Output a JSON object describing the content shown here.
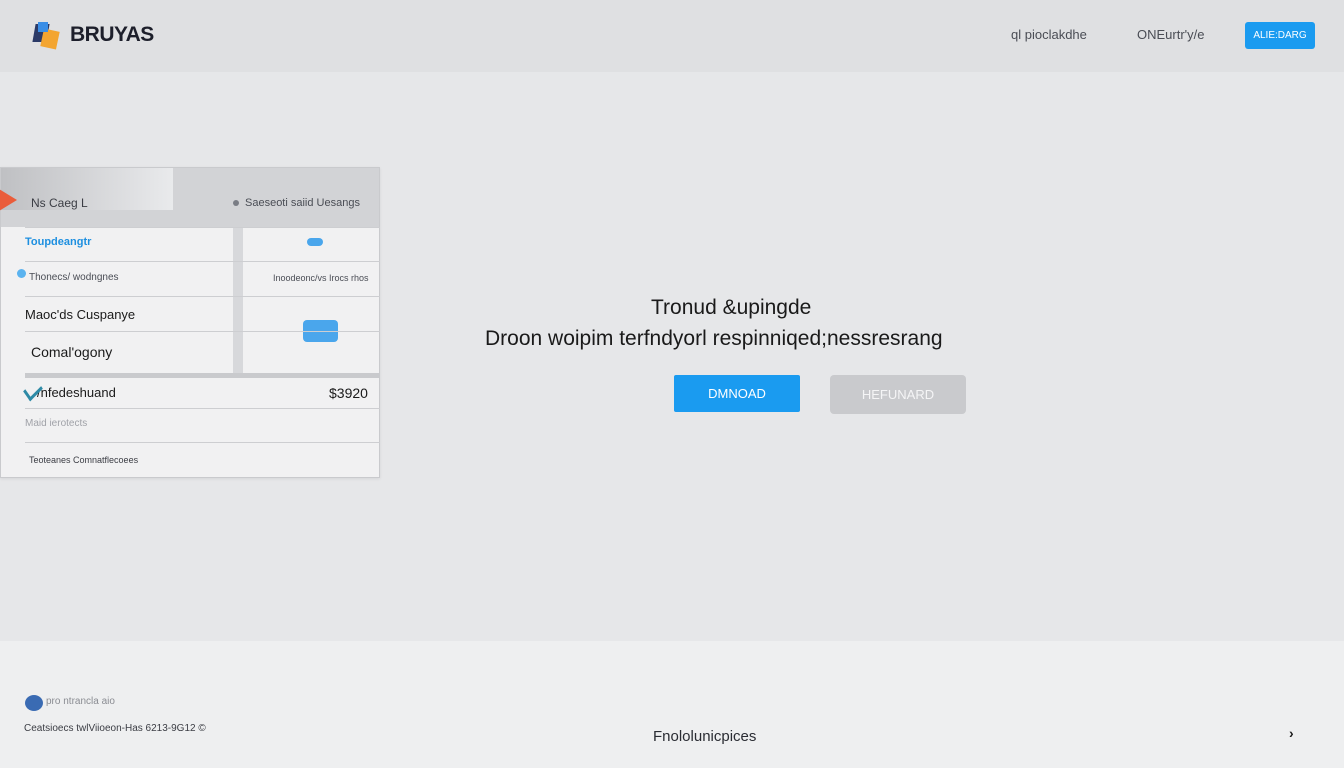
{
  "header": {
    "logo_text": "BRUYAS",
    "nav": [
      "ql pioclakdhe",
      "ONEurtr'y/e"
    ],
    "cta_label": "ALIE:DARG"
  },
  "panel": {
    "head_left": "Ns  Caeg     L",
    "head_right": "Saeseoti saiid Uesangs",
    "rows": [
      {
        "label": "Toupdeangtr",
        "value": ""
      },
      {
        "label": "Thonecs/ wodngnes",
        "value": "Inoodeonc/vs Irocs rhos"
      },
      {
        "label": "Maoc'ds Cuspanye",
        "value": ""
      },
      {
        "label": "Comal'ogony",
        "value": ""
      },
      {
        "label": "/nfedeshuand",
        "value": "$3920"
      },
      {
        "label": "Maid ierotects",
        "value": ""
      },
      {
        "label": "Teoteanes Comnatflecoees",
        "value": ""
      }
    ]
  },
  "hero": {
    "title": "Tronud &upingde",
    "subtitle": "Droon woipim terfndyorl respinniqed;nessresrang",
    "primary_label": "DMNOAD",
    "secondary_label": "HEFUNARD"
  },
  "footer": {
    "icon_label": "pro ntrancla aio",
    "copyright": "Ceatsioecs  twlViioeon-Has  6213-9G12 ©",
    "center_text": "Fnololunicpices",
    "chevron": "›"
  },
  "colors": {
    "accent": "#1a9bf0",
    "marker": "#ea5c3a"
  }
}
